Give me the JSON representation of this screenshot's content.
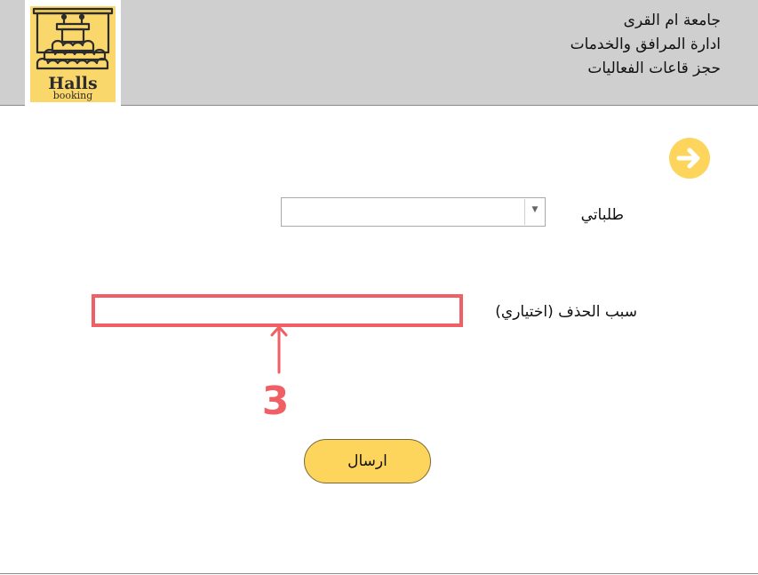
{
  "header": {
    "lines": [
      "جامعة ام القرى",
      "ادارة المرافق والخدمات",
      "حجز قاعات الفعاليات"
    ],
    "logo": {
      "word": "Halls",
      "subword": "booking",
      "icon": "lecture-hall-icon",
      "bg": "#fad76b"
    }
  },
  "nav": {
    "back_icon": "arrow-circle-right-icon",
    "color": "#fdd55c"
  },
  "form": {
    "requests_label": "طلباتي",
    "requests_value": "",
    "reason_label": "سبب الحذف (اختياري)",
    "reason_value": "",
    "submit_label": "ارسال"
  },
  "annotation": {
    "step_number": "3",
    "color": "#ef5f63"
  },
  "colors": {
    "header_bg": "#cfcfcf",
    "button": "#fdd55c",
    "highlight": "#ef5f63"
  }
}
